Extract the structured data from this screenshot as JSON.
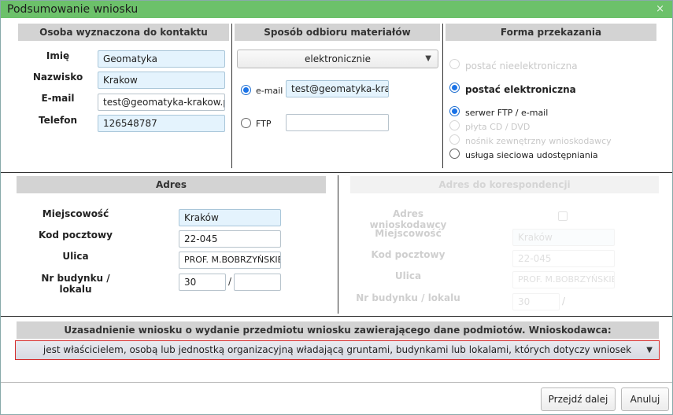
{
  "dialog": {
    "title": "Podsumowanie wniosku",
    "close": "×"
  },
  "contact": {
    "header": "Osoba wyznaczona do kontaktu",
    "first_name_label": "Imię",
    "first_name": "Geomatyka",
    "last_name_label": "Nazwisko",
    "last_name": "Krakow",
    "email_label": "E-mail",
    "email": "test@geomatyka-krakow.pl",
    "phone_label": "Telefon",
    "phone": "126548787"
  },
  "delivery": {
    "header": "Sposób odbioru materiałów",
    "method_selected": "elektronicznie",
    "email_option": "e-mail",
    "email_value": "test@geomatyka-krakow.pl",
    "ftp_option": "FTP",
    "ftp_value": ""
  },
  "transfer": {
    "header": "Forma przekazania",
    "non_electronic": "postać nieelektroniczna",
    "electronic": "postać elektroniczna",
    "ftp_email": "serwer FTP / e-mail",
    "cd_dvd": "płyta CD / DVD",
    "external_media": "nośnik zewnętrzny wnioskodawcy",
    "network_service": "usługa sieciowa udostępniania"
  },
  "address": {
    "header": "Adres",
    "city_label": "Miejscowość",
    "city": "Kraków",
    "postal_label": "Kod pocztowy",
    "postal": "22-045",
    "street_label": "Ulica",
    "street": "PROF. M.BOBRZYŃSKIEGO",
    "number_label": "Nr budynku / lokalu",
    "building": "30",
    "slash": "/",
    "unit": ""
  },
  "correspondence": {
    "header": "Adres do korespondencji",
    "applicant_address_label": "Adres wnioskodawcy",
    "city_label": "Miejscowość",
    "city": "Kraków",
    "postal_label": "Kod pocztowy",
    "postal": "22-045",
    "street_label": "Ulica",
    "street": "PROF. M.BOBRZYŃSKIEGO",
    "number_label": "Nr budynku / lokalu",
    "building": "30",
    "slash": "/"
  },
  "justification": {
    "header": "Uzasadnienie wniosku o wydanie przedmiotu wniosku zawierającego dane podmiotów. Wnioskodawca:",
    "selected": "jest właścicielem, osobą lub jednostką organizacyjną władającą gruntami, budynkami lub lokalami, których dotyczy wniosek"
  },
  "buttons": {
    "next": "Przejdź dalej",
    "cancel": "Anuluj"
  },
  "colors": {
    "titlebar": "#6cc16a",
    "radio_selected": "#1a73e8",
    "validation_border": "#d52b2b"
  }
}
